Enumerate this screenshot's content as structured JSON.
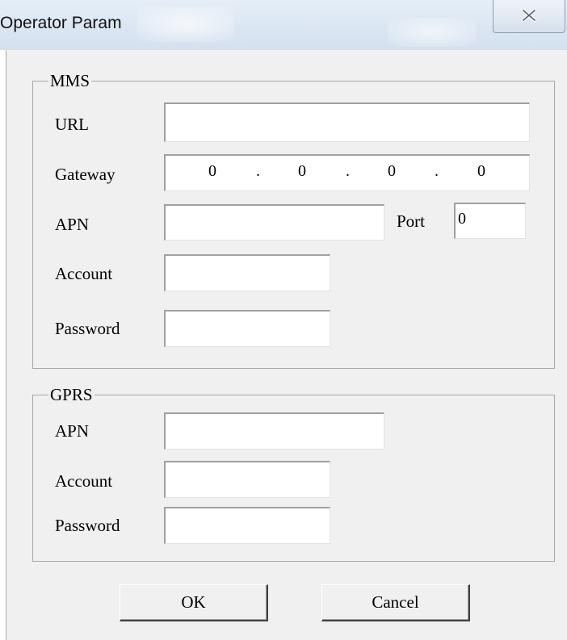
{
  "window": {
    "title": "Operator Param",
    "close_glyph": "✕"
  },
  "mms": {
    "legend": "MMS",
    "url_label": "URL",
    "url_value": "",
    "gateway_label": "Gateway",
    "gateway_octets": [
      "0",
      "0",
      "0",
      "0"
    ],
    "gateway_separator": ".",
    "apn_label": "APN",
    "apn_value": "",
    "port_label": "Port",
    "port_value": "0",
    "account_label": "Account",
    "account_value": "",
    "password_label": "Password",
    "password_value": ""
  },
  "gprs": {
    "legend": "GPRS",
    "apn_label": "APN",
    "apn_value": "",
    "account_label": "Account",
    "account_value": "",
    "password_label": "Password",
    "password_value": ""
  },
  "buttons": {
    "ok": "OK",
    "cancel": "Cancel"
  }
}
